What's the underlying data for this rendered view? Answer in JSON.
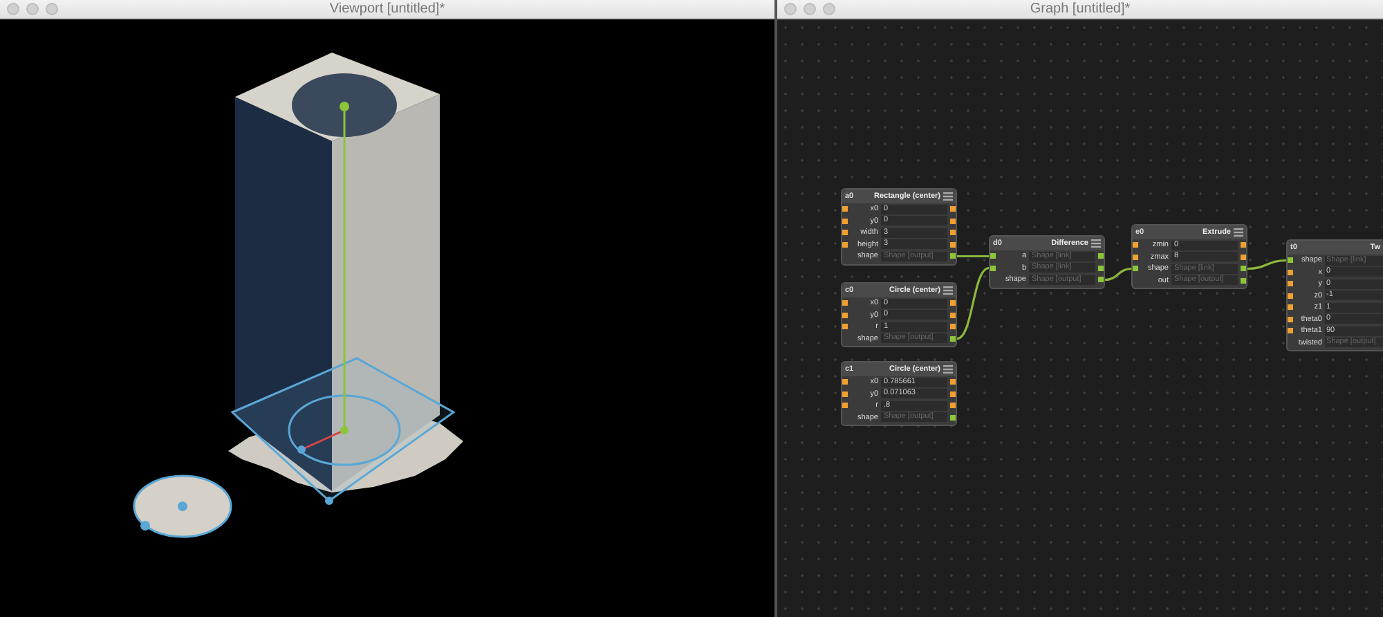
{
  "viewport": {
    "title": "Viewport [untitled]*"
  },
  "graph": {
    "title": "Graph [untitled]*",
    "nodes": [
      {
        "id": "a0",
        "title": "Rectangle (center)",
        "rows": [
          {
            "label": "x0",
            "value": "0",
            "kind": "number"
          },
          {
            "label": "y0",
            "value": "0",
            "kind": "number"
          },
          {
            "label": "width",
            "value": "3",
            "kind": "number"
          },
          {
            "label": "height",
            "value": "3",
            "kind": "number"
          },
          {
            "label": "shape",
            "placeholder": "Shape [output]",
            "kind": "output"
          }
        ]
      },
      {
        "id": "c0",
        "title": "Circle (center)",
        "rows": [
          {
            "label": "x0",
            "value": "0",
            "kind": "number"
          },
          {
            "label": "y0",
            "value": "0",
            "kind": "number"
          },
          {
            "label": "r",
            "value": "1",
            "kind": "number"
          },
          {
            "label": "shape",
            "placeholder": "Shape [output]",
            "kind": "output"
          }
        ]
      },
      {
        "id": "c1",
        "title": "Circle (center)",
        "rows": [
          {
            "label": "x0",
            "value": "0.785661",
            "kind": "number"
          },
          {
            "label": "y0",
            "value": "0.071063",
            "kind": "number"
          },
          {
            "label": "r",
            "value": ".8",
            "kind": "number"
          },
          {
            "label": "shape",
            "placeholder": "Shape [output]",
            "kind": "output"
          }
        ]
      },
      {
        "id": "d0",
        "title": "Difference",
        "rows": [
          {
            "label": "a",
            "placeholder": "Shape [link]",
            "kind": "input"
          },
          {
            "label": "b",
            "placeholder": "Shape [link]",
            "kind": "input"
          },
          {
            "label": "shape",
            "placeholder": "Shape [output]",
            "kind": "output"
          }
        ]
      },
      {
        "id": "e0",
        "title": "Extrude",
        "rows": [
          {
            "label": "zmin",
            "value": "0",
            "kind": "number"
          },
          {
            "label": "zmax",
            "value": "8",
            "kind": "number"
          },
          {
            "label": "shape",
            "placeholder": "Shape [link]",
            "kind": "input"
          },
          {
            "label": "out",
            "placeholder": "Shape [output]",
            "kind": "output"
          }
        ]
      },
      {
        "id": "t0",
        "title": "Tw",
        "rows": [
          {
            "label": "shape",
            "placeholder": "Shape [link]",
            "kind": "input"
          },
          {
            "label": "x",
            "value": "0",
            "kind": "number"
          },
          {
            "label": "y",
            "value": "0",
            "kind": "number"
          },
          {
            "label": "z0",
            "value": "-1",
            "kind": "number"
          },
          {
            "label": "z1",
            "value": "1",
            "kind": "number"
          },
          {
            "label": "theta0",
            "value": "0",
            "kind": "number"
          },
          {
            "label": "theta1",
            "value": "90",
            "kind": "number"
          },
          {
            "label": "twisted",
            "placeholder": "Shape [output]",
            "kind": "output"
          }
        ]
      }
    ]
  }
}
